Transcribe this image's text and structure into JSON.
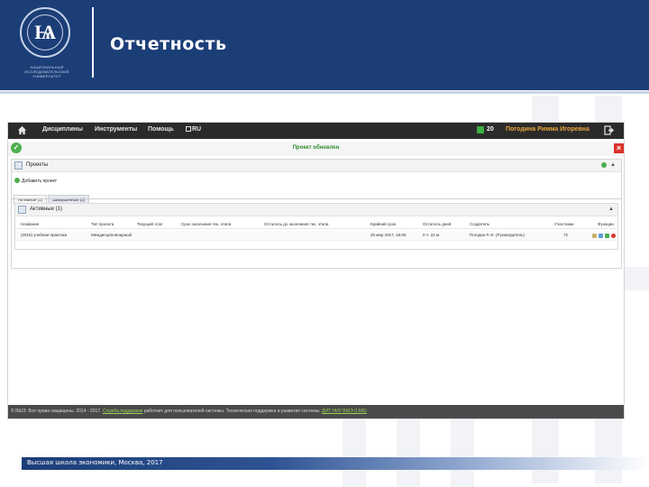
{
  "slide": {
    "title": "Отчетность",
    "logo_caption": "НАЦИОНАЛЬНЫЙ ИССЛЕДОВАТЕЛЬСКИЙ УНИВЕРСИТЕТ",
    "footer": "Высшая школа экономики, Москва, 2017"
  },
  "app": {
    "nav": {
      "items": [
        "Дисциплины",
        "Инструменты",
        "Помощь",
        "RU"
      ],
      "messages_count": "20",
      "user_name": "Погодина Римма Игоревна"
    },
    "notice": "Проект обновлен",
    "projects": {
      "title": "Проекты",
      "add_label": "Добавить проект",
      "tabs": [
        "Активные (1)",
        "Завершенные (0)"
      ]
    },
    "active": {
      "title": "Активные (1)",
      "columns": [
        "Название",
        "Тип проекта",
        "Текущий этап",
        "Срок окончания тек. этапа",
        "Осталось до окончания тек. этапа",
        "Крайний срок",
        "Осталось дней",
        "Создатель",
        "Участники",
        "Функции"
      ],
      "rows": [
        [
          "(2016) учебная практика",
          "Междисциплинарный",
          "",
          "",
          "",
          "25 мар 2017, 15:00",
          "0 ч. 22 м.",
          "Погодин Р. И. (Руководитель)",
          "72",
          ""
        ]
      ]
    },
    "footer": {
      "prefix": "© ВШЭ. Все права защищены. 2014 - 2017. ",
      "support_link": "Служба поддержки",
      "middle": " работает для пользователей системы. Техническая поддержка и развитие системы: ",
      "dev_link": "ДИТ НИУ ВШЭ (LMS)"
    }
  },
  "colors": {
    "brand": "#1c3e77",
    "nav_bg": "#2b2b2b",
    "user_name": "#e8a33c",
    "notice": "#2e8b2e",
    "success": "#4caf50",
    "danger": "#d9332b"
  }
}
